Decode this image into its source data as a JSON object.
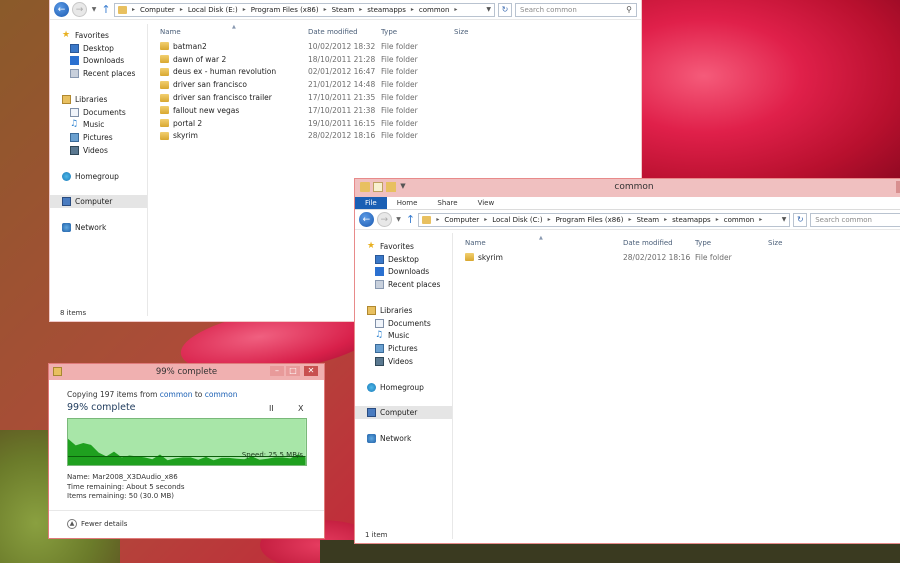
{
  "nav": {
    "favorites": "Favorites",
    "desktop": "Desktop",
    "downloads": "Downloads",
    "recent": "Recent places",
    "libraries": "Libraries",
    "documents": "Documents",
    "music": "Music",
    "pictures": "Pictures",
    "videos": "Videos",
    "homegroup": "Homegroup",
    "computer": "Computer",
    "network": "Network"
  },
  "columns": {
    "name": "Name",
    "date": "Date modified",
    "type": "Type",
    "size": "Size"
  },
  "search_placeholder": "Search common",
  "window1": {
    "breadcrumbs": [
      "Computer",
      "Local Disk (E:)",
      "Program Files (x86)",
      "Steam",
      "steamapps",
      "common"
    ],
    "files": [
      {
        "name": "batman2",
        "date": "10/02/2012 18:32",
        "type": "File folder"
      },
      {
        "name": "dawn of war 2",
        "date": "18/10/2011 21:28",
        "type": "File folder"
      },
      {
        "name": "deus ex - human revolution",
        "date": "02/01/2012 16:47",
        "type": "File folder"
      },
      {
        "name": "driver san francisco",
        "date": "21/01/2012 14:48",
        "type": "File folder"
      },
      {
        "name": "driver san francisco trailer",
        "date": "17/10/2011 21:35",
        "type": "File folder"
      },
      {
        "name": "fallout new vegas",
        "date": "17/10/2011 21:38",
        "type": "File folder"
      },
      {
        "name": "portal 2",
        "date": "19/10/2011 16:15",
        "type": "File folder"
      },
      {
        "name": "skyrim",
        "date": "28/02/2012 18:16",
        "type": "File folder"
      }
    ],
    "status": "8 items"
  },
  "window2": {
    "title": "common",
    "ribbon_tabs": [
      "File",
      "Home",
      "Share",
      "View"
    ],
    "breadcrumbs": [
      "Computer",
      "Local Disk (C:)",
      "Program Files (x86)",
      "Steam",
      "steamapps",
      "common"
    ],
    "files": [
      {
        "name": "skyrim",
        "date": "28/02/2012 18:16",
        "type": "File folder"
      }
    ],
    "status": "1 item"
  },
  "copy_dialog": {
    "title": "99% complete",
    "copying_prefix": "Copying 197 items from",
    "source": "common",
    "to_word": "to",
    "dest": "common",
    "percent_text": "99% complete",
    "percent": 99,
    "pause_glyph": "II",
    "cancel_glyph": "X",
    "speed": "Speed: 25.5 MB/s",
    "name_line": "Name:  Mar2008_X3DAudio_x86",
    "time_line": "Time remaining:  About 5 seconds",
    "items_line": "Items remaining:  50 (30.0 MB)",
    "fewer_details": "Fewer details",
    "accent_color": "#1fa01f",
    "fill_color": "#c6f0c6"
  }
}
